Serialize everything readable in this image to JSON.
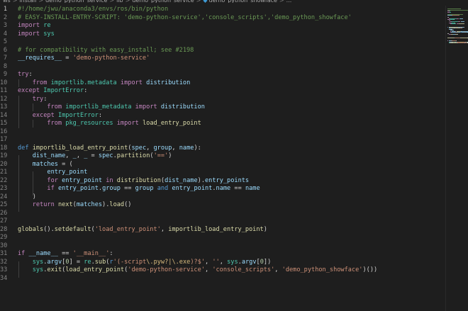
{
  "breadcrumb": {
    "items": [
      "_ws",
      "install",
      "demo_python_service",
      "lib",
      "demo_python_service",
      "demo_python_showface",
      "..."
    ]
  },
  "colors": {
    "background": "#1e1e1e",
    "comment": "#6a9955",
    "keyword": "#c586c0",
    "string": "#ce9178",
    "function": "#dcdcaa"
  },
  "editor": {
    "lines": [
      {
        "n": "1",
        "tokens": [
          {
            "c": "c-com",
            "t": "#!/home/jwu/anaconda3/envs/ros/bin/python"
          }
        ]
      },
      {
        "n": "2",
        "tokens": [
          {
            "c": "c-com",
            "t": "# EASY-INSTALL-ENTRY-SCRIPT: 'demo-python-service','console_scripts','demo_python_showface'"
          }
        ]
      },
      {
        "n": "3",
        "tokens": [
          {
            "c": "c-kw",
            "t": "import"
          },
          {
            "c": "",
            "t": " "
          },
          {
            "c": "c-cls",
            "t": "re"
          }
        ]
      },
      {
        "n": "4",
        "tokens": [
          {
            "c": "c-kw",
            "t": "import"
          },
          {
            "c": "",
            "t": " "
          },
          {
            "c": "c-cls",
            "t": "sys"
          }
        ]
      },
      {
        "n": "5",
        "tokens": []
      },
      {
        "n": "6",
        "tokens": [
          {
            "c": "c-com",
            "t": "# for compatibility with easy_install; see #2198"
          }
        ]
      },
      {
        "n": "7",
        "tokens": [
          {
            "c": "c-var",
            "t": "__requires__"
          },
          {
            "c": "",
            "t": " = "
          },
          {
            "c": "c-str",
            "t": "'demo-python-service'"
          }
        ]
      },
      {
        "n": "8",
        "tokens": []
      },
      {
        "n": "9",
        "tokens": [
          {
            "c": "c-kw",
            "t": "try"
          },
          {
            "c": "",
            "t": ":"
          }
        ]
      },
      {
        "n": "10",
        "tokens": [
          {
            "c": "",
            "t": "    "
          },
          {
            "c": "c-kw",
            "t": "from"
          },
          {
            "c": "",
            "t": " "
          },
          {
            "c": "c-cls",
            "t": "importlib.metadata"
          },
          {
            "c": "",
            "t": " "
          },
          {
            "c": "c-kw",
            "t": "import"
          },
          {
            "c": "",
            "t": " "
          },
          {
            "c": "c-var",
            "t": "distribution"
          }
        ]
      },
      {
        "n": "11",
        "tokens": [
          {
            "c": "c-kw",
            "t": "except"
          },
          {
            "c": "",
            "t": " "
          },
          {
            "c": "c-cls",
            "t": "ImportError"
          },
          {
            "c": "",
            "t": ":"
          }
        ]
      },
      {
        "n": "12",
        "tokens": [
          {
            "c": "",
            "t": "    "
          },
          {
            "c": "c-kw",
            "t": "try"
          },
          {
            "c": "",
            "t": ":"
          }
        ]
      },
      {
        "n": "13",
        "tokens": [
          {
            "c": "",
            "t": "        "
          },
          {
            "c": "c-kw",
            "t": "from"
          },
          {
            "c": "",
            "t": " "
          },
          {
            "c": "c-cls",
            "t": "importlib_metadata"
          },
          {
            "c": "",
            "t": " "
          },
          {
            "c": "c-kw",
            "t": "import"
          },
          {
            "c": "",
            "t": " "
          },
          {
            "c": "c-var",
            "t": "distribution"
          }
        ]
      },
      {
        "n": "14",
        "tokens": [
          {
            "c": "",
            "t": "    "
          },
          {
            "c": "c-kw",
            "t": "except"
          },
          {
            "c": "",
            "t": " "
          },
          {
            "c": "c-cls",
            "t": "ImportError"
          },
          {
            "c": "",
            "t": ":"
          }
        ]
      },
      {
        "n": "15",
        "tokens": [
          {
            "c": "",
            "t": "        "
          },
          {
            "c": "c-kw",
            "t": "from"
          },
          {
            "c": "",
            "t": " "
          },
          {
            "c": "c-cls",
            "t": "pkg_resources"
          },
          {
            "c": "",
            "t": " "
          },
          {
            "c": "c-kw",
            "t": "import"
          },
          {
            "c": "",
            "t": " "
          },
          {
            "c": "c-fn",
            "t": "load_entry_point"
          }
        ]
      },
      {
        "n": "16",
        "tokens": []
      },
      {
        "n": "17",
        "tokens": []
      },
      {
        "n": "18",
        "tokens": [
          {
            "c": "c-key",
            "t": "def"
          },
          {
            "c": "",
            "t": " "
          },
          {
            "c": "c-fn",
            "t": "importlib_load_entry_point"
          },
          {
            "c": "",
            "t": "("
          },
          {
            "c": "c-var",
            "t": "spec"
          },
          {
            "c": "",
            "t": ", "
          },
          {
            "c": "c-var",
            "t": "group"
          },
          {
            "c": "",
            "t": ", "
          },
          {
            "c": "c-var",
            "t": "name"
          },
          {
            "c": "",
            "t": "):"
          }
        ]
      },
      {
        "n": "19",
        "tokens": [
          {
            "c": "",
            "t": "    "
          },
          {
            "c": "c-var",
            "t": "dist_name"
          },
          {
            "c": "",
            "t": ", "
          },
          {
            "c": "c-var",
            "t": "_"
          },
          {
            "c": "",
            "t": ", "
          },
          {
            "c": "c-var",
            "t": "_"
          },
          {
            "c": "",
            "t": " = "
          },
          {
            "c": "c-var",
            "t": "spec"
          },
          {
            "c": "",
            "t": "."
          },
          {
            "c": "c-fn",
            "t": "partition"
          },
          {
            "c": "",
            "t": "("
          },
          {
            "c": "c-str",
            "t": "'=='"
          },
          {
            "c": "",
            "t": ")"
          }
        ]
      },
      {
        "n": "20",
        "tokens": [
          {
            "c": "",
            "t": "    "
          },
          {
            "c": "c-var",
            "t": "matches"
          },
          {
            "c": "",
            "t": " = ("
          }
        ]
      },
      {
        "n": "21",
        "tokens": [
          {
            "c": "",
            "t": "        "
          },
          {
            "c": "c-var",
            "t": "entry_point"
          }
        ]
      },
      {
        "n": "22",
        "tokens": [
          {
            "c": "",
            "t": "        "
          },
          {
            "c": "c-kw",
            "t": "for"
          },
          {
            "c": "",
            "t": " "
          },
          {
            "c": "c-var",
            "t": "entry_point"
          },
          {
            "c": "",
            "t": " "
          },
          {
            "c": "c-kw",
            "t": "in"
          },
          {
            "c": "",
            "t": " "
          },
          {
            "c": "c-fn",
            "t": "distribution"
          },
          {
            "c": "",
            "t": "("
          },
          {
            "c": "c-var",
            "t": "dist_name"
          },
          {
            "c": "",
            "t": ")."
          },
          {
            "c": "c-var",
            "t": "entry_points"
          }
        ]
      },
      {
        "n": "23",
        "tokens": [
          {
            "c": "",
            "t": "        "
          },
          {
            "c": "c-kw",
            "t": "if"
          },
          {
            "c": "",
            "t": " "
          },
          {
            "c": "c-var",
            "t": "entry_point"
          },
          {
            "c": "",
            "t": "."
          },
          {
            "c": "c-var",
            "t": "group"
          },
          {
            "c": "",
            "t": " == "
          },
          {
            "c": "c-var",
            "t": "group"
          },
          {
            "c": "",
            "t": " "
          },
          {
            "c": "c-key",
            "t": "and"
          },
          {
            "c": "",
            "t": " "
          },
          {
            "c": "c-var",
            "t": "entry_point"
          },
          {
            "c": "",
            "t": "."
          },
          {
            "c": "c-var",
            "t": "name"
          },
          {
            "c": "",
            "t": " == "
          },
          {
            "c": "c-var",
            "t": "name"
          }
        ]
      },
      {
        "n": "24",
        "tokens": [
          {
            "c": "",
            "t": "    )"
          }
        ]
      },
      {
        "n": "25",
        "tokens": [
          {
            "c": "",
            "t": "    "
          },
          {
            "c": "c-kw",
            "t": "return"
          },
          {
            "c": "",
            "t": " "
          },
          {
            "c": "c-fn",
            "t": "next"
          },
          {
            "c": "",
            "t": "("
          },
          {
            "c": "c-var",
            "t": "matches"
          },
          {
            "c": "",
            "t": ")."
          },
          {
            "c": "c-fn",
            "t": "load"
          },
          {
            "c": "",
            "t": "()"
          }
        ]
      },
      {
        "n": "26",
        "tokens": []
      },
      {
        "n": "27",
        "tokens": []
      },
      {
        "n": "28",
        "tokens": [
          {
            "c": "c-fn",
            "t": "globals"
          },
          {
            "c": "",
            "t": "()."
          },
          {
            "c": "c-fn",
            "t": "setdefault"
          },
          {
            "c": "",
            "t": "("
          },
          {
            "c": "c-str",
            "t": "'load_entry_point'"
          },
          {
            "c": "",
            "t": ", "
          },
          {
            "c": "c-fn",
            "t": "importlib_load_entry_point"
          },
          {
            "c": "",
            "t": ")"
          }
        ]
      },
      {
        "n": "29",
        "tokens": []
      },
      {
        "n": "30",
        "tokens": []
      },
      {
        "n": "31",
        "tokens": [
          {
            "c": "c-kw",
            "t": "if"
          },
          {
            "c": "",
            "t": " "
          },
          {
            "c": "c-var",
            "t": "__name__"
          },
          {
            "c": "",
            "t": " == "
          },
          {
            "c": "c-str",
            "t": "'__main__'"
          },
          {
            "c": "",
            "t": ":"
          }
        ]
      },
      {
        "n": "32",
        "tokens": [
          {
            "c": "",
            "t": "    "
          },
          {
            "c": "c-cls",
            "t": "sys"
          },
          {
            "c": "",
            "t": "."
          },
          {
            "c": "c-var",
            "t": "argv"
          },
          {
            "c": "",
            "t": "["
          },
          {
            "c": "c-num",
            "t": "0"
          },
          {
            "c": "",
            "t": "] = "
          },
          {
            "c": "c-cls",
            "t": "re"
          },
          {
            "c": "",
            "t": "."
          },
          {
            "c": "c-fn",
            "t": "sub"
          },
          {
            "c": "",
            "t": "("
          },
          {
            "c": "c-key",
            "t": "r"
          },
          {
            "c": "c-str",
            "t": "'(-script"
          },
          {
            "c": "c-esc",
            "t": "\\.pyw?|\\.exe"
          },
          {
            "c": "c-str",
            "t": ")?$'"
          },
          {
            "c": "",
            "t": ", "
          },
          {
            "c": "c-str",
            "t": "''"
          },
          {
            "c": "",
            "t": ", "
          },
          {
            "c": "c-cls",
            "t": "sys"
          },
          {
            "c": "",
            "t": "."
          },
          {
            "c": "c-var",
            "t": "argv"
          },
          {
            "c": "",
            "t": "["
          },
          {
            "c": "c-num",
            "t": "0"
          },
          {
            "c": "",
            "t": "])"
          }
        ]
      },
      {
        "n": "33",
        "tokens": [
          {
            "c": "",
            "t": "    "
          },
          {
            "c": "c-cls",
            "t": "sys"
          },
          {
            "c": "",
            "t": "."
          },
          {
            "c": "c-fn",
            "t": "exit"
          },
          {
            "c": "",
            "t": "("
          },
          {
            "c": "c-fn",
            "t": "load_entry_point"
          },
          {
            "c": "",
            "t": "("
          },
          {
            "c": "c-str",
            "t": "'demo-python-service'"
          },
          {
            "c": "",
            "t": ", "
          },
          {
            "c": "c-str",
            "t": "'console_scripts'"
          },
          {
            "c": "",
            "t": ", "
          },
          {
            "c": "c-str",
            "t": "'demo_python_showface'"
          },
          {
            "c": "",
            "t": ")())"
          }
        ]
      },
      {
        "n": "34",
        "tokens": []
      }
    ]
  }
}
